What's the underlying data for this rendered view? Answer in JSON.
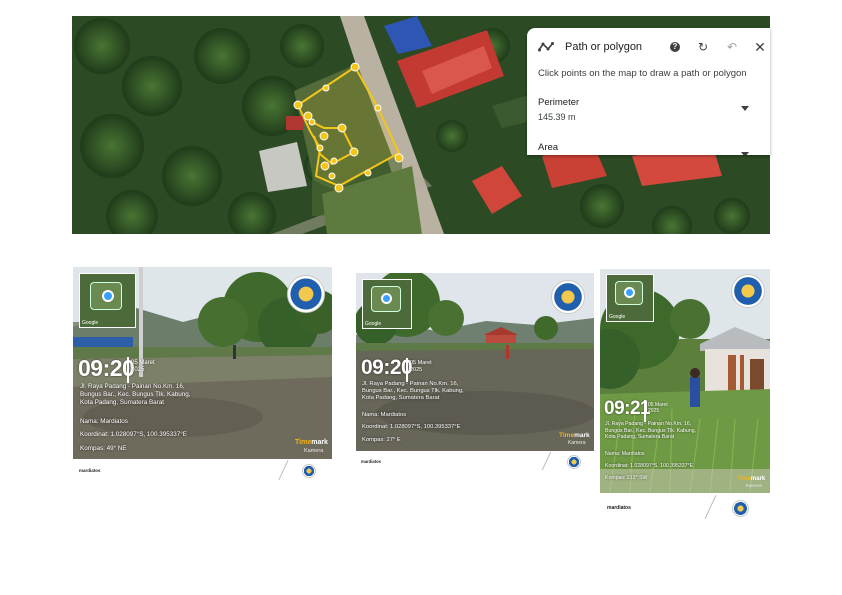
{
  "panel": {
    "title": "Path or polygon",
    "hint": "Click points on the map to draw a path or polygon",
    "perimeter_label": "Perimeter",
    "perimeter_value": "145.39 m",
    "area_label": "Area",
    "icons": [
      "path-icon",
      "help-icon",
      "redo-icon",
      "undo-icon",
      "close-icon"
    ],
    "polygon_color": "#f5c518"
  },
  "photos": [
    {
      "time": "09:20",
      "date_line1": "05 Maret",
      "date_line2": "2025",
      "address_line1": "Jl. Raya Padang - Painan No.Km. 16,",
      "address_line2": "Bungus Bar., Kec. Bungus Tlk. Kabung,",
      "address_line3": "Kota Padang, Sumatera Barat",
      "name": "Nama: Mardiatos",
      "coords": "Koordinat: 1.028097°S, 100.395337°E",
      "compass": "Kompas: 49° NE",
      "brand_a": "Time",
      "brand_b": "mark",
      "brand_sub": "Kamera",
      "map_label": "Google",
      "footer": "mardiatos"
    },
    {
      "time": "09:20",
      "date_line1": "05 Maret",
      "date_line2": "2025",
      "address_line1": "Jl. Raya Padang - Painan No.Km. 16,",
      "address_line2": "Bungus Bar., Kec. Bungus Tlk. Kabung,",
      "address_line3": "Kota Padang, Sumatera Barat",
      "name": "Nama: Mardiatos",
      "coords": "Koordinat: 1.028097°S, 100.395337°E",
      "compass": "Kompas: 27° E",
      "brand_a": "Time",
      "brand_b": "mark",
      "brand_sub": "Kamera",
      "map_label": "Google",
      "footer": "mardiatos"
    },
    {
      "time": "09:21",
      "date_line1": "05 Maret",
      "date_line2": "2025",
      "address_line1": "Jl. Raya Padang - Painan No.Km. 16,",
      "address_line2": "Bungus Bar., Kec. Bungus Tlk. Kabung,",
      "address_line3": "Kota Padang, Sumatera Barat",
      "name": "Nama: Mardiatos",
      "coords": "Koordinat: 1.028097°S, 100.395337°E",
      "compass": "Kompas: 213° SW",
      "brand_a": "Time",
      "brand_b": "mark",
      "brand_sub": "Kamera",
      "map_label": "Google",
      "footer": "mardiatos"
    }
  ]
}
